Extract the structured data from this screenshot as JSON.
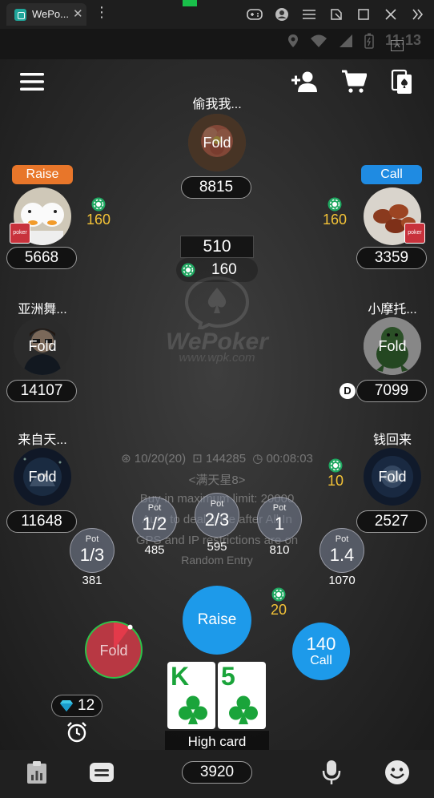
{
  "browser": {
    "tab_title": "WePo...",
    "tab_close": "✕",
    "menu_glyph": "⋮"
  },
  "status": {
    "time": "11:13"
  },
  "pot": {
    "total": "510",
    "side": "160"
  },
  "watermark": {
    "title": "WePoker",
    "url": "www.wpk.com"
  },
  "table": {
    "blinds": "10/20(20)",
    "table_id": "144285",
    "elapsed": "00:08:03",
    "room_name": "<满天星8>",
    "buyin_line": "Buy-in maximum limit: 20000",
    "rule_line": "Auto to deal once after All In",
    "gps_line": "GPS and IP restrictions are on",
    "entry_line": "Random Entry"
  },
  "seats": [
    {
      "id": "top",
      "name": "偷我我...",
      "stack": "8815",
      "status": "Fold",
      "action": "",
      "bet": ""
    },
    {
      "id": "top-left",
      "name": "",
      "stack": "5668",
      "status": "",
      "action": "Raise",
      "bet": "160"
    },
    {
      "id": "top-right",
      "name": "",
      "stack": "3359",
      "status": "",
      "action": "Call",
      "bet": "160"
    },
    {
      "id": "mid-left",
      "name": "亚洲舞...",
      "stack": "14107",
      "status": "Fold",
      "action": "",
      "bet": ""
    },
    {
      "id": "mid-right",
      "name": "小摩托...",
      "stack": "7099",
      "status": "Fold",
      "action": "",
      "bet": ""
    },
    {
      "id": "low-left",
      "name": "来自天...",
      "stack": "11648",
      "status": "Fold",
      "action": "",
      "bet": ""
    },
    {
      "id": "low-right",
      "name": "钱回来",
      "stack": "2527",
      "status": "Fold",
      "action": "",
      "bet": "10"
    }
  ],
  "mini_card_label": "poker",
  "dealer_label": "D",
  "pot_buttons": [
    {
      "top": "Pot",
      "frac": "1/3",
      "amount": "381"
    },
    {
      "top": "Pot",
      "frac": "1/2",
      "amount": "485"
    },
    {
      "top": "Pot",
      "frac": "2/3",
      "amount": "595"
    },
    {
      "top": "Pot",
      "frac": "1",
      "amount": "810"
    },
    {
      "top": "Pot",
      "frac": "1.4",
      "amount": "1070"
    }
  ],
  "actions": {
    "raise": "Raise",
    "call_label": "Call",
    "call_amount": "140",
    "fold": "Fold",
    "fold_timer_fraction": 0.1
  },
  "hero": {
    "bet": "20",
    "cards": [
      {
        "rank": "K",
        "suit": "clubs"
      },
      {
        "rank": "5",
        "suit": "clubs"
      }
    ],
    "hand_name": "High card",
    "stack": "3920",
    "diamonds": "12"
  },
  "colors": {
    "accent_blue": "#1d9aea",
    "raise_orange": "#e8762a",
    "call_blue": "#1f8be2",
    "chip_green": "#1fa861",
    "bet_gold": "#f3c237",
    "card_green": "#1aa43a",
    "timer_green": "#2ec24a",
    "timer_red": "#e33a4a"
  },
  "icons": {
    "menu": "hamburger-icon",
    "add_friend": "add-friend-icon",
    "shop": "cart-icon",
    "records": "cards-icon",
    "stats": "stats-icon",
    "chat": "chat-icon",
    "voice": "microphone-icon",
    "emoji": "smiley-icon"
  }
}
